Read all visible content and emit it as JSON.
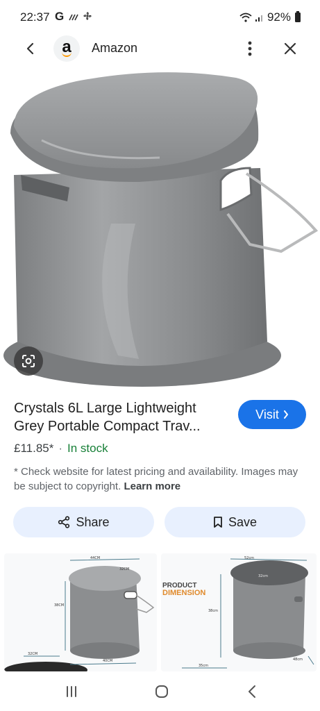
{
  "status_bar": {
    "time": "22:37",
    "g_label": "G",
    "battery": "92%"
  },
  "app_bar": {
    "logo_letter": "a",
    "source": "Amazon"
  },
  "product": {
    "title_line1": "Crystals 6L Large Lightweight",
    "title_line2": "Grey Portable Compact Trav...",
    "price": "£11.85*",
    "separator": "·",
    "availability": "In stock",
    "disclaimer": "* Check website for latest pricing and availability. Images may be subject to copyright.",
    "learn_more": "Learn more"
  },
  "buttons": {
    "visit": "Visit",
    "share": "Share",
    "save": "Save"
  },
  "thumbnails": {
    "dimension_line1": "PRODUCT",
    "dimension_line2": "DIMENSION",
    "measurements": [
      "44CM",
      "32CM",
      "38CM",
      "40CM",
      "32CM",
      "52cm",
      "32cm",
      "35cm",
      "38cm",
      "48cm"
    ]
  },
  "colors": {
    "accent_blue": "#1a73e8",
    "stock_green": "#188038",
    "chip_bg": "#e8f0fe",
    "product_grey": "#8e9092",
    "dimension_orange": "#e08a2c"
  }
}
